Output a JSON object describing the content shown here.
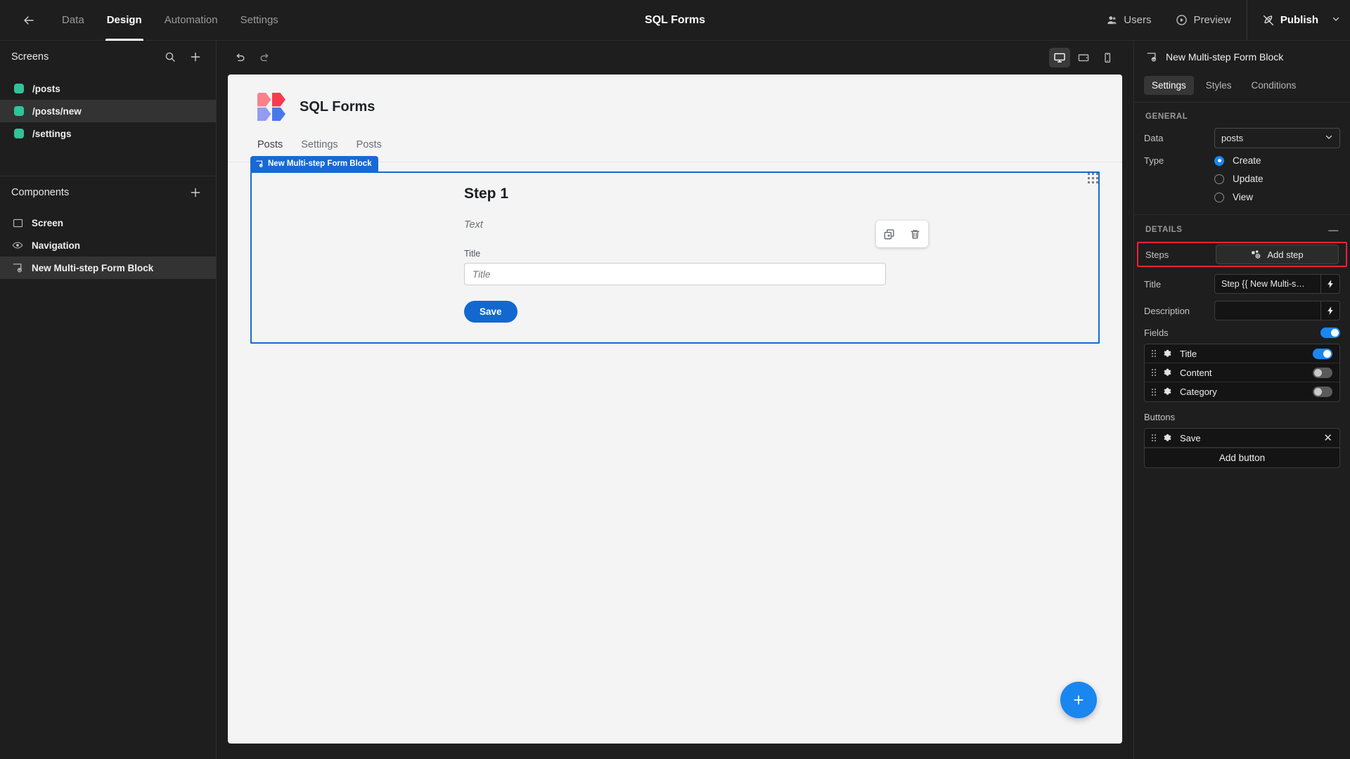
{
  "topbar": {
    "back_icon": "arrow-left-icon",
    "nav": [
      {
        "label": "Data",
        "active": false
      },
      {
        "label": "Design",
        "active": true
      },
      {
        "label": "Automation",
        "active": false
      },
      {
        "label": "Settings",
        "active": false
      }
    ],
    "title": "SQL Forms",
    "users_label": "Users",
    "preview_label": "Preview",
    "publish_label": "Publish"
  },
  "sidebar": {
    "screens_title": "Screens",
    "screens": [
      {
        "label": "/posts",
        "selected": false,
        "color": "#2fc49a"
      },
      {
        "label": "/posts/new",
        "selected": true,
        "color": "#2fc49a"
      },
      {
        "label": "/settings",
        "selected": false,
        "color": "#2fc49a"
      }
    ],
    "components_title": "Components",
    "components": [
      {
        "label": "Screen",
        "icon": "screen-icon",
        "selected": false
      },
      {
        "label": "Navigation",
        "icon": "eye-icon",
        "selected": false
      },
      {
        "label": "New Multi-step Form Block",
        "icon": "multistep-form-icon",
        "selected": true
      }
    ]
  },
  "canvas": {
    "viewports": [
      {
        "name": "desktop",
        "active": true
      },
      {
        "name": "tablet",
        "active": false
      },
      {
        "name": "mobile",
        "active": false
      }
    ],
    "brand_name": "SQL Forms",
    "logo_colors": [
      "#f98289",
      "#fa3b4c",
      "#939cf0",
      "#4a78ea"
    ],
    "site_tabs": [
      "Posts",
      "Settings",
      "Posts"
    ],
    "block_badge": "New Multi-step Form Block",
    "step_title": "Step 1",
    "step_text": "Text",
    "field_label": "Title",
    "field_placeholder": "Title",
    "field_value": "",
    "save_label": "Save",
    "accent": "#1769d6"
  },
  "inspector": {
    "header_title": "New Multi-step Form Block",
    "tabs": [
      {
        "label": "Settings",
        "active": true
      },
      {
        "label": "Styles",
        "active": false
      },
      {
        "label": "Conditions",
        "active": false
      }
    ],
    "general_title": "GENERAL",
    "data_label": "Data",
    "data_value": "posts",
    "type_label": "Type",
    "type_options": [
      {
        "label": "Create",
        "selected": true
      },
      {
        "label": "Update",
        "selected": false
      },
      {
        "label": "View",
        "selected": false
      }
    ],
    "details_title": "DETAILS",
    "steps_label": "Steps",
    "add_step_label": "Add step",
    "title_label": "Title",
    "title_value": "Step {{ New Multi-s…",
    "description_label": "Description",
    "description_value": "",
    "fields_label": "Fields",
    "fields_enabled": true,
    "fields": [
      {
        "label": "Title",
        "enabled": true
      },
      {
        "label": "Content",
        "enabled": false
      },
      {
        "label": "Category",
        "enabled": false
      }
    ],
    "buttons_label": "Buttons",
    "buttons": [
      {
        "label": "Save"
      }
    ],
    "add_button_label": "Add button",
    "highlight_color": "#f0213a"
  }
}
